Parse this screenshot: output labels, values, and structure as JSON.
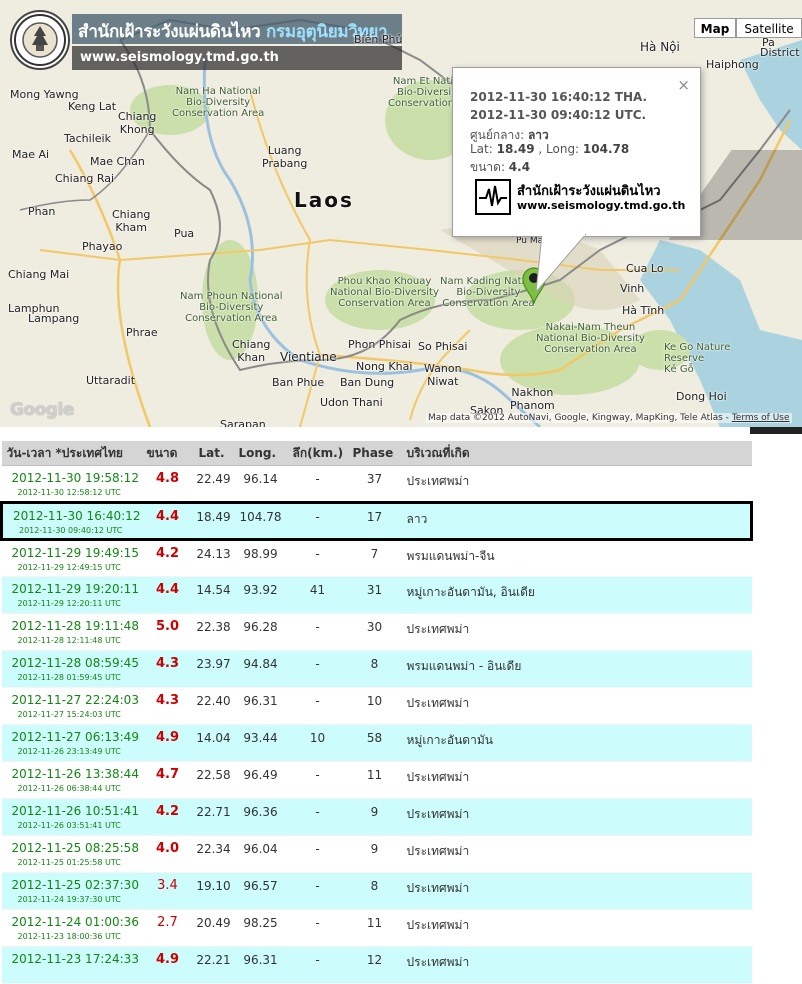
{
  "banner": {
    "title_part1": "สำนักเฝ้าระวังแผ่นดินไหว",
    "title_part2": "กรมอุตุนิยมวิทยา",
    "url": "www.seismology.tmd.go.th"
  },
  "map": {
    "type_map": "Map",
    "type_satellite": "Satellite",
    "google": "Google",
    "attribution": "Map data ©2012 AutoNavi, Google, Kingway, MapKing, Tele Atlas -",
    "terms": "Terms of Use",
    "labels": {
      "laos": "Laos",
      "hanoi": "Hà Nội",
      "haiphong": "Haiphong",
      "pa": "Pa",
      "district": "District",
      "bienphu": "Biên Phủ",
      "kenglat": "Keng Lat",
      "mongyawng": "Mong Yawng",
      "namet": "Nam Et Natio",
      "namet2": "Bio-Diversit",
      "namet3": "Conservation A",
      "namha1": "Nam Ha National",
      "namha2": "Bio-Diversity",
      "namha3": "Conservation Area",
      "luang1": "Luang",
      "luang2": "Prabang",
      "tachilek": "Tachileik",
      "chiangkhong1": "Chiang",
      "chiangkhong2": "Khong",
      "maeai": "Mae Ai",
      "maechan": "Mae Chan",
      "chiangrai": "Chiang Rai",
      "phan": "Phan",
      "phayao": "Phayao",
      "chiangkham1": "Chiang",
      "chiangkham2": "Kham",
      "pua": "Pua",
      "chiangmai": "Chiang Mai",
      "lampang": "Lampang",
      "lamphun": "Lamphun",
      "phrae": "Phrae",
      "uttaradit": "Uttaradit",
      "namphoun1": "Nam Phoun National",
      "namphoun2": "Bio-Diversity",
      "namphoun3": "Conservation Area",
      "phoukhao1": "Phou Khao Khouay",
      "phoukhao2": "National Bio-Diversity",
      "phoukhao3": "Conservation Area",
      "namkading1": "Nam Kading Nation",
      "namkading2": "Bio-Diversity",
      "namkading3": "Conservation Area",
      "vientiane": "Vientiane",
      "chiangkhan1": "Chiang",
      "chiangkhan2": "Khan",
      "phonphisai": "Phon Phisai",
      "sophisai": "So Phisai",
      "banphue": "Ban Phue",
      "nongkhai": "Nong Khai",
      "bandung": "Ban Dung",
      "wanon1": "Wanon",
      "wanon2": "Niwat",
      "udonthani": "Udon Thani",
      "sakon1": "Sakon",
      "sakon2": "Nakhon",
      "nakhon1": "Nakhon",
      "nakhon2": "Phanom",
      "sarapat": "Sarapan",
      "cualo": "Cua Lo",
      "vinh": "Vinh",
      "hatinh": "Hà Tĩnh",
      "nakai1": "Nakai-Nam Theun",
      "nakai2": "National Bio-Diversity",
      "nakai3": "Conservation Area",
      "kego1": "Ke Go Nature",
      "kego2": "Reserve",
      "kego3": "Kẻ Gỗ",
      "donghoi": "Dong Hoi",
      "puman": "Pu Mat"
    }
  },
  "infowindow": {
    "line_tha": "2012-11-30 16:40:12 THA.",
    "line_utc": "2012-11-30 09:40:12 UTC.",
    "center_label": "ศูนย์กลาง: ",
    "center_value": "ลาว",
    "lat_label": "Lat: ",
    "lat_value": "18.49",
    "long_label": " , Long: ",
    "long_value": "104.78",
    "mag_label": "ขนาด: ",
    "mag_value": "4.4",
    "logo_text": "สำนักเฝ้าระวังแผ่นดินไหว",
    "logo_url": "www.seismology.tmd.go.th",
    "close": "×"
  },
  "table": {
    "headers": [
      "วัน-เวลา *ประเทศไทย",
      "ขนาด",
      "Lat.",
      "Long.",
      "ลึก(km.)",
      "Phase",
      "บริเวณที่เกิด"
    ],
    "rows": [
      {
        "time": "2012-11-30 19:58:12",
        "utc": "2012-11-30 12:58:12 UTC",
        "mag": "4.8",
        "lat": "22.49",
        "long": "96.14",
        "depth": "-",
        "phase": "37",
        "area": "ประเทศพม่า"
      },
      {
        "time": "2012-11-30 16:40:12",
        "utc": "2012-11-30 09:40:12 UTC",
        "mag": "4.4",
        "lat": "18.49",
        "long": "104.78",
        "depth": "-",
        "phase": "17",
        "area": "ลาว"
      },
      {
        "time": "2012-11-29 19:49:15",
        "utc": "2012-11-29 12:49:15 UTC",
        "mag": "4.2",
        "lat": "24.13",
        "long": "98.99",
        "depth": "-",
        "phase": "7",
        "area": "พรมแดนพม่า-จีน"
      },
      {
        "time": "2012-11-29 19:20:11",
        "utc": "2012-11-29 12:20:11 UTC",
        "mag": "4.4",
        "lat": "14.54",
        "long": "93.92",
        "depth": "41",
        "phase": "31",
        "area": "หมู่เกาะอันดามัน, อินเดีย"
      },
      {
        "time": "2012-11-28 19:11:48",
        "utc": "2012-11-28 12:11:48 UTC",
        "mag": "5.0",
        "lat": "22.38",
        "long": "96.28",
        "depth": "-",
        "phase": "30",
        "area": "ประเทศพม่า"
      },
      {
        "time": "2012-11-28 08:59:45",
        "utc": "2012-11-28 01:59:45 UTC",
        "mag": "4.3",
        "lat": "23.97",
        "long": "94.84",
        "depth": "-",
        "phase": "8",
        "area": "พรมแดนพม่า - อินเดีย"
      },
      {
        "time": "2012-11-27 22:24:03",
        "utc": "2012-11-27 15:24:03 UTC",
        "mag": "4.3",
        "lat": "22.40",
        "long": "96.31",
        "depth": "-",
        "phase": "10",
        "area": "ประเทศพม่า"
      },
      {
        "time": "2012-11-27 06:13:49",
        "utc": "2012-11-26 23:13:49 UTC",
        "mag": "4.9",
        "lat": "14.04",
        "long": "93.44",
        "depth": "10",
        "phase": "58",
        "area": "หมู่เกาะอันดามัน"
      },
      {
        "time": "2012-11-26 13:38:44",
        "utc": "2012-11-26 06:38:44 UTC",
        "mag": "4.7",
        "lat": "22.58",
        "long": "96.49",
        "depth": "-",
        "phase": "11",
        "area": "ประเทศพม่า"
      },
      {
        "time": "2012-11-26 10:51:41",
        "utc": "2012-11-26 03:51:41 UTC",
        "mag": "4.2",
        "lat": "22.71",
        "long": "96.36",
        "depth": "-",
        "phase": "9",
        "area": "ประเทศพม่า"
      },
      {
        "time": "2012-11-25 08:25:58",
        "utc": "2012-11-25 01:25:58 UTC",
        "mag": "4.0",
        "lat": "22.34",
        "long": "96.04",
        "depth": "-",
        "phase": "9",
        "area": "ประเทศพม่า"
      },
      {
        "time": "2012-11-25 02:37:30",
        "utc": "2012-11-24 19:37:30 UTC",
        "mag": "3.4",
        "lat": "19.10",
        "long": "96.57",
        "depth": "-",
        "phase": "8",
        "area": "ประเทศพม่า"
      },
      {
        "time": "2012-11-24 01:00:36",
        "utc": "2012-11-23 18:00:36 UTC",
        "mag": "2.7",
        "lat": "20.49",
        "long": "98.25",
        "depth": "-",
        "phase": "11",
        "area": "ประเทศพม่า"
      },
      {
        "time": "2012-11-23 17:24:33",
        "utc": "",
        "mag": "4.9",
        "lat": "22.21",
        "long": "96.31",
        "depth": "-",
        "phase": "12",
        "area": "ประเทศพม่า"
      }
    ],
    "selected_index": 1
  },
  "colors": {
    "row_alt": "#ccfcfc",
    "header_bg": "#d5d5d5",
    "time_green": "#118811",
    "mag_red": "#cc0000",
    "marker_green": "#7cc043"
  }
}
